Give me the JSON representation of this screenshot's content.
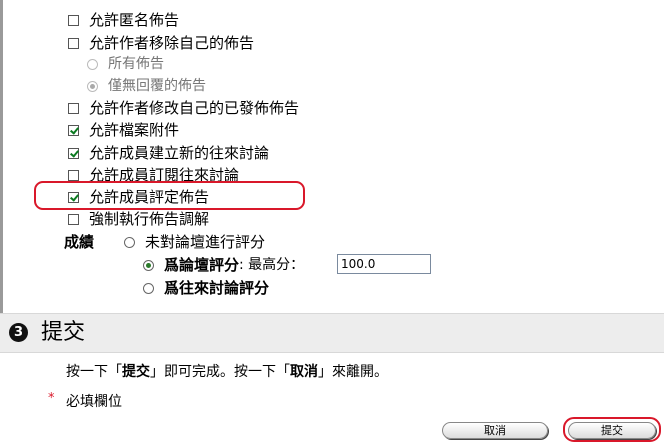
{
  "options": {
    "anonymous": {
      "label": "允許匿名佈告",
      "checked": false
    },
    "remove_own": {
      "label": "允許作者移除自己的佈告",
      "checked": false
    },
    "remove_all": {
      "label": "所有佈告"
    },
    "remove_no_reply": {
      "label": "僅無回覆的佈告"
    },
    "edit_published": {
      "label": "允許作者修改自己的已發佈佈告",
      "checked": false
    },
    "attachments": {
      "label": "允許檔案附件",
      "checked": true
    },
    "create_threads": {
      "label": "允許成員建立新的往來討論",
      "checked": true
    },
    "subscribe": {
      "label": "允許成員訂閱往來討論",
      "checked": false
    },
    "rate_posts": {
      "label": "允許成員評定佈告",
      "checked": true
    },
    "force_moderation": {
      "label": "強制執行佈告調解",
      "checked": false
    }
  },
  "grade": {
    "label": "成績",
    "no_grade": "未對論壇進行評分",
    "forum_grade": "爲論壇評分",
    "max_points_label": ": 最高分：",
    "max_points_value": "100.0",
    "thread_grade": "爲往來討論評分"
  },
  "submit_section": {
    "number": "3",
    "title": "提交",
    "instr_1": "按一下「",
    "instr_submit": "提交",
    "instr_2": "」即可完成。按一下「",
    "instr_cancel": "取消",
    "instr_3": "」來離開。",
    "required_mark": "*",
    "required_label": "必填欄位"
  },
  "buttons": {
    "cancel": "取消",
    "submit": "提交"
  },
  "colors": {
    "highlight": "#d9182a",
    "check": "#0a7a20"
  }
}
